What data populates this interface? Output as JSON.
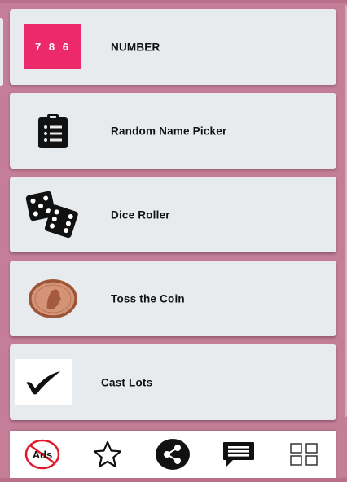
{
  "menu": {
    "items": [
      {
        "label": "NUMBER",
        "icon": "number-icon",
        "tile_text": "7 8 6",
        "tile_color": "#ec2a6b"
      },
      {
        "label": "Random Name Picker",
        "icon": "clipboard-list-icon"
      },
      {
        "label": "Dice Roller",
        "icon": "dice-icon"
      },
      {
        "label": "Toss the Coin",
        "icon": "coin-icon"
      },
      {
        "label": "Cast Lots",
        "icon": "checkmark-icon"
      }
    ]
  },
  "bottom_nav": {
    "remove_ads_label": "Ads",
    "buttons": [
      "remove-ads-icon",
      "star-icon",
      "share-icon",
      "feedback-icon",
      "grid-icon"
    ]
  },
  "colors": {
    "background": "#c57e97",
    "card": "#e8ebee",
    "no_ads_red": "#e0192a"
  }
}
